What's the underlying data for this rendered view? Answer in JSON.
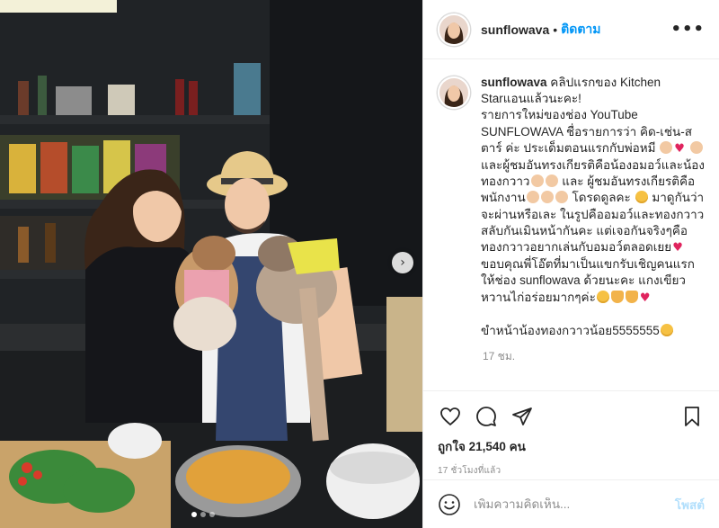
{
  "post": {
    "username": "sunflowava",
    "follow_label": "ติดตาม",
    "separator": "•",
    "more_label": "•••",
    "caption_username": "sunflowava",
    "caption_part1": " คลิปแรกของ Kitchen Starแอนแล้วนะคะ!\nรายการใหม่ของช่อง YouTube SUNFLOWAVA ชื่อรายการว่า คิด-เช่น-สตาร์ ค่ะ ประเด็มตอนแรกกับพ่อหมี",
    "caption_part2": " และผู้ชมอันทรงเกียรติคือน้องอมอว์และน้องทองกวาว",
    "caption_part3": " และ ผู้ชมอันทรงเกียรติคือพนักงาน",
    "caption_part4": " โดรดดูลคะ",
    "caption_part5": " มาดูกันว่าจะผ่านหรือเละ ในรูปคืออมอว์และทองกวาวสลับกันเมินหน้ากันคะ แต่เจอกันจริงๆคือทองกวาวอยากเล่นกับอมอว์ตลอดเยย",
    "caption_part6": "\nขอบคุณพี่โอ๊ตที่มาเป็นแขกรับเชิญคนแรกให้ช่อง sunflowava ด้วยนะคะ แกงเขียวหวานไก่อร่อยมากๆค่ะ",
    "caption_part7": "\n\nขำหน้าน้องทองกวาวน้อย5555555",
    "caption_time": "17 ชม.",
    "likes_label": "ถูกใจ 21,540 คน",
    "post_time": "17 ชั่วโมงที่แล้ว",
    "comment_placeholder": "เพิ่มความคิดเห็น...",
    "post_button": "โพสต์",
    "carousel_next": "›"
  },
  "icons": {
    "like": "heart-outline-icon",
    "comment": "comment-bubble-icon",
    "share": "paper-plane-icon",
    "save": "bookmark-icon",
    "emoji": "smiley-icon",
    "more": "more-dots-icon"
  },
  "colors": {
    "link_blue": "#0095f6",
    "post_button_disabled": "#b2dffc",
    "muted_text": "#8e8e8e",
    "border": "#efefef"
  },
  "carousel": {
    "total": 3,
    "active": 1
  }
}
